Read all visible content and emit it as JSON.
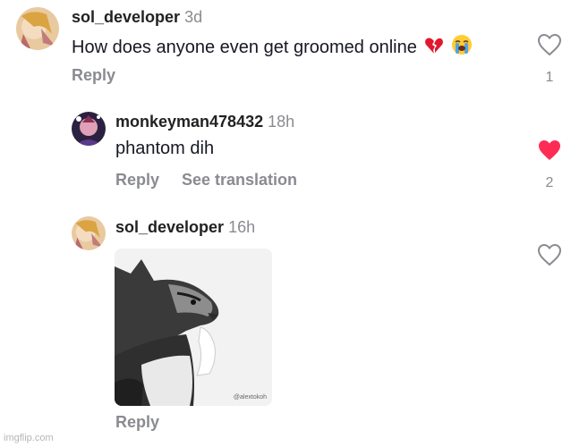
{
  "comments": [
    {
      "username": "sol_developer",
      "time": "3d",
      "text": "How does anyone even get groomed online",
      "emojis": [
        "broken-heart-emoji",
        "loudly-crying-face-emoji"
      ],
      "reply_label": "Reply",
      "likes": "1",
      "liked": false
    },
    {
      "username": "monkeyman478432",
      "time": "18h",
      "text": "phantom dih",
      "reply_label": "Reply",
      "translate_label": "See translation",
      "likes": "2",
      "liked": true
    },
    {
      "username": "sol_developer",
      "time": "16h",
      "gif_watermark": "@alextokoh",
      "reply_label": "Reply",
      "likes": "",
      "liked": false
    }
  ],
  "colors": {
    "liked_heart": "#fe2c55",
    "muted_text": "#8a8b91"
  },
  "icons": [
    "heart-outline-icon",
    "heart-filled-icon"
  ],
  "site_watermark": "imgflip.com"
}
